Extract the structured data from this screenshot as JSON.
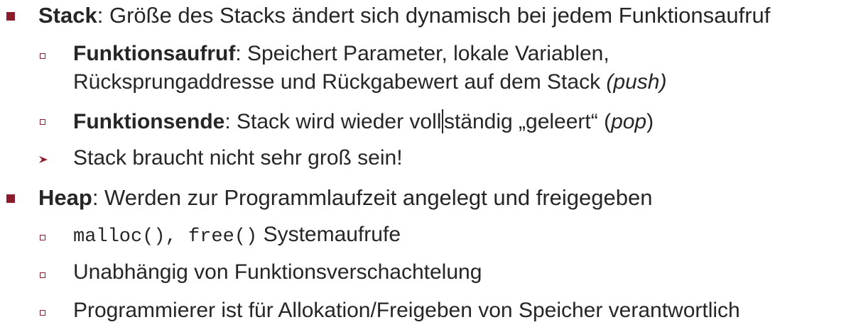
{
  "colors": {
    "bullet": "#8b1c2c",
    "text": "#262626"
  },
  "icons": {
    "level1": "filled-square-bullet",
    "level2": "hollow-square-bullet",
    "arrow": "arrowhead-bullet"
  },
  "stack": {
    "term": "Stack",
    "text": ": Größe des Stacks ändert sich dynamisch bei jedem Funktionsaufruf",
    "call": {
      "term": "Funktionsaufruf",
      "text_line1": ": Speichert Parameter, lokale Variablen,",
      "text_line2": "Rücksprungaddresse und Rückgabewert auf dem Stack ",
      "note": "(push)"
    },
    "end": {
      "term": "Funktionsende",
      "text_a": ": Stack wird wieder voll",
      "text_b": "ständig „geleert“ (",
      "italic": "pop",
      "text_c": ")"
    },
    "note": "Stack braucht nicht sehr groß sein!"
  },
  "heap": {
    "term": "Heap",
    "text": ": Werden zur Programmlaufzeit angelegt und freigegeben",
    "syscalls": {
      "code1": "malloc()",
      "sep": ", ",
      "code2": "free()",
      "text": " Systemaufrufe"
    },
    "independent": "Unabhängig von Funktionsverschachtelung",
    "responsibility": "Programmierer ist für Allokation/Freigeben von Speicher verantwortlich"
  }
}
